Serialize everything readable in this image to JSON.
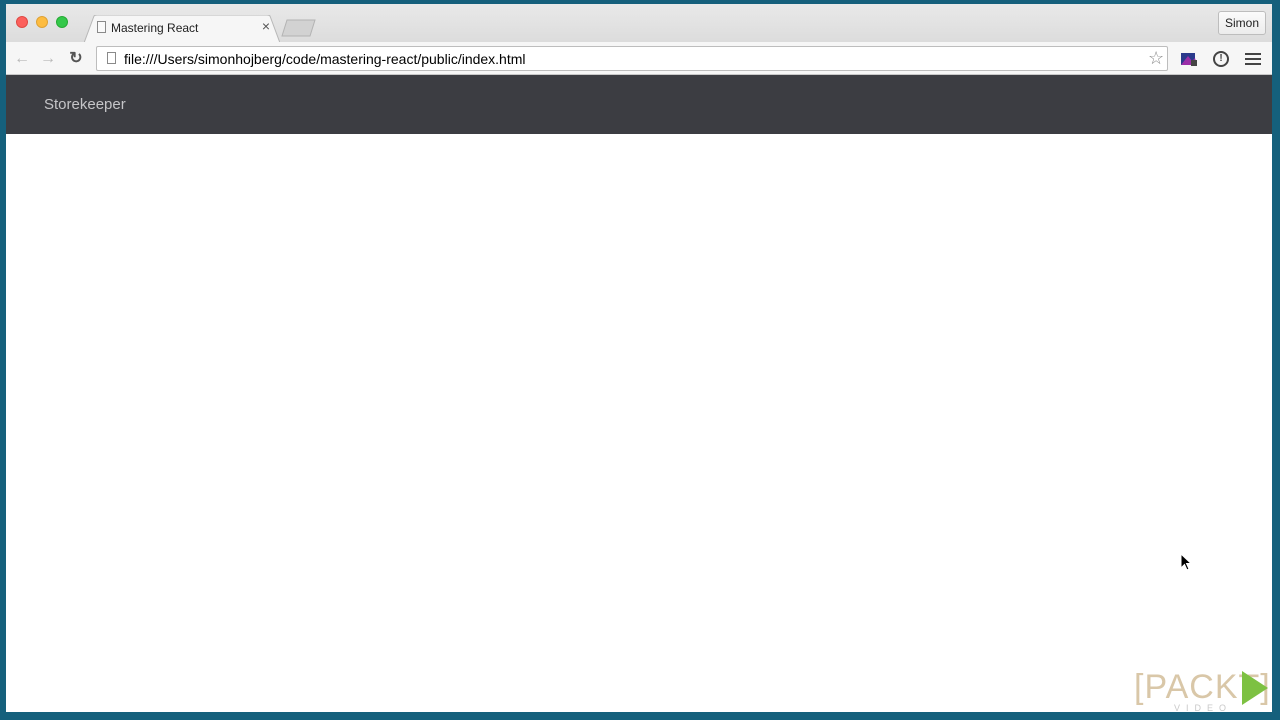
{
  "browser": {
    "tab": {
      "title": "Mastering React",
      "close_glyph": "×"
    },
    "profile_button": "Simon",
    "address_bar": {
      "url": "file:///Users/simonhojberg/code/mastering-react/public/index.html"
    },
    "icons": {
      "back": "back-arrow-icon",
      "forward": "forward-arrow-icon",
      "reload": "reload-icon",
      "bookmark": "star-icon",
      "extension": "extension-icon",
      "info": "info-icon",
      "menu": "hamburger-menu-icon"
    }
  },
  "page": {
    "navbar": {
      "brand": "Storekeeper",
      "background": "#3c3d42"
    }
  },
  "watermark": {
    "brand": "[PACKT]",
    "sub": "VIDEO"
  }
}
